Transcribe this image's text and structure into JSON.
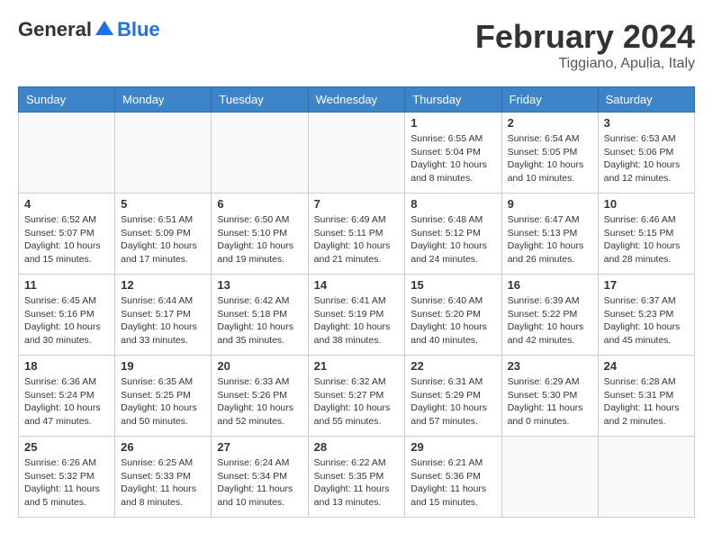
{
  "logo": {
    "general": "General",
    "blue": "Blue"
  },
  "title": "February 2024",
  "subtitle": "Tiggiano, Apulia, Italy",
  "days_of_week": [
    "Sunday",
    "Monday",
    "Tuesday",
    "Wednesday",
    "Thursday",
    "Friday",
    "Saturday"
  ],
  "weeks": [
    {
      "days": [
        {
          "num": "",
          "info": ""
        },
        {
          "num": "",
          "info": ""
        },
        {
          "num": "",
          "info": ""
        },
        {
          "num": "",
          "info": ""
        },
        {
          "num": "1",
          "info": "Sunrise: 6:55 AM\nSunset: 5:04 PM\nDaylight: 10 hours\nand 8 minutes."
        },
        {
          "num": "2",
          "info": "Sunrise: 6:54 AM\nSunset: 5:05 PM\nDaylight: 10 hours\nand 10 minutes."
        },
        {
          "num": "3",
          "info": "Sunrise: 6:53 AM\nSunset: 5:06 PM\nDaylight: 10 hours\nand 12 minutes."
        }
      ]
    },
    {
      "days": [
        {
          "num": "4",
          "info": "Sunrise: 6:52 AM\nSunset: 5:07 PM\nDaylight: 10 hours\nand 15 minutes."
        },
        {
          "num": "5",
          "info": "Sunrise: 6:51 AM\nSunset: 5:09 PM\nDaylight: 10 hours\nand 17 minutes."
        },
        {
          "num": "6",
          "info": "Sunrise: 6:50 AM\nSunset: 5:10 PM\nDaylight: 10 hours\nand 19 minutes."
        },
        {
          "num": "7",
          "info": "Sunrise: 6:49 AM\nSunset: 5:11 PM\nDaylight: 10 hours\nand 21 minutes."
        },
        {
          "num": "8",
          "info": "Sunrise: 6:48 AM\nSunset: 5:12 PM\nDaylight: 10 hours\nand 24 minutes."
        },
        {
          "num": "9",
          "info": "Sunrise: 6:47 AM\nSunset: 5:13 PM\nDaylight: 10 hours\nand 26 minutes."
        },
        {
          "num": "10",
          "info": "Sunrise: 6:46 AM\nSunset: 5:15 PM\nDaylight: 10 hours\nand 28 minutes."
        }
      ]
    },
    {
      "days": [
        {
          "num": "11",
          "info": "Sunrise: 6:45 AM\nSunset: 5:16 PM\nDaylight: 10 hours\nand 30 minutes."
        },
        {
          "num": "12",
          "info": "Sunrise: 6:44 AM\nSunset: 5:17 PM\nDaylight: 10 hours\nand 33 minutes."
        },
        {
          "num": "13",
          "info": "Sunrise: 6:42 AM\nSunset: 5:18 PM\nDaylight: 10 hours\nand 35 minutes."
        },
        {
          "num": "14",
          "info": "Sunrise: 6:41 AM\nSunset: 5:19 PM\nDaylight: 10 hours\nand 38 minutes."
        },
        {
          "num": "15",
          "info": "Sunrise: 6:40 AM\nSunset: 5:20 PM\nDaylight: 10 hours\nand 40 minutes."
        },
        {
          "num": "16",
          "info": "Sunrise: 6:39 AM\nSunset: 5:22 PM\nDaylight: 10 hours\nand 42 minutes."
        },
        {
          "num": "17",
          "info": "Sunrise: 6:37 AM\nSunset: 5:23 PM\nDaylight: 10 hours\nand 45 minutes."
        }
      ]
    },
    {
      "days": [
        {
          "num": "18",
          "info": "Sunrise: 6:36 AM\nSunset: 5:24 PM\nDaylight: 10 hours\nand 47 minutes."
        },
        {
          "num": "19",
          "info": "Sunrise: 6:35 AM\nSunset: 5:25 PM\nDaylight: 10 hours\nand 50 minutes."
        },
        {
          "num": "20",
          "info": "Sunrise: 6:33 AM\nSunset: 5:26 PM\nDaylight: 10 hours\nand 52 minutes."
        },
        {
          "num": "21",
          "info": "Sunrise: 6:32 AM\nSunset: 5:27 PM\nDaylight: 10 hours\nand 55 minutes."
        },
        {
          "num": "22",
          "info": "Sunrise: 6:31 AM\nSunset: 5:29 PM\nDaylight: 10 hours\nand 57 minutes."
        },
        {
          "num": "23",
          "info": "Sunrise: 6:29 AM\nSunset: 5:30 PM\nDaylight: 11 hours\nand 0 minutes."
        },
        {
          "num": "24",
          "info": "Sunrise: 6:28 AM\nSunset: 5:31 PM\nDaylight: 11 hours\nand 2 minutes."
        }
      ]
    },
    {
      "days": [
        {
          "num": "25",
          "info": "Sunrise: 6:26 AM\nSunset: 5:32 PM\nDaylight: 11 hours\nand 5 minutes."
        },
        {
          "num": "26",
          "info": "Sunrise: 6:25 AM\nSunset: 5:33 PM\nDaylight: 11 hours\nand 8 minutes."
        },
        {
          "num": "27",
          "info": "Sunrise: 6:24 AM\nSunset: 5:34 PM\nDaylight: 11 hours\nand 10 minutes."
        },
        {
          "num": "28",
          "info": "Sunrise: 6:22 AM\nSunset: 5:35 PM\nDaylight: 11 hours\nand 13 minutes."
        },
        {
          "num": "29",
          "info": "Sunrise: 6:21 AM\nSunset: 5:36 PM\nDaylight: 11 hours\nand 15 minutes."
        },
        {
          "num": "",
          "info": ""
        },
        {
          "num": "",
          "info": ""
        }
      ]
    }
  ]
}
